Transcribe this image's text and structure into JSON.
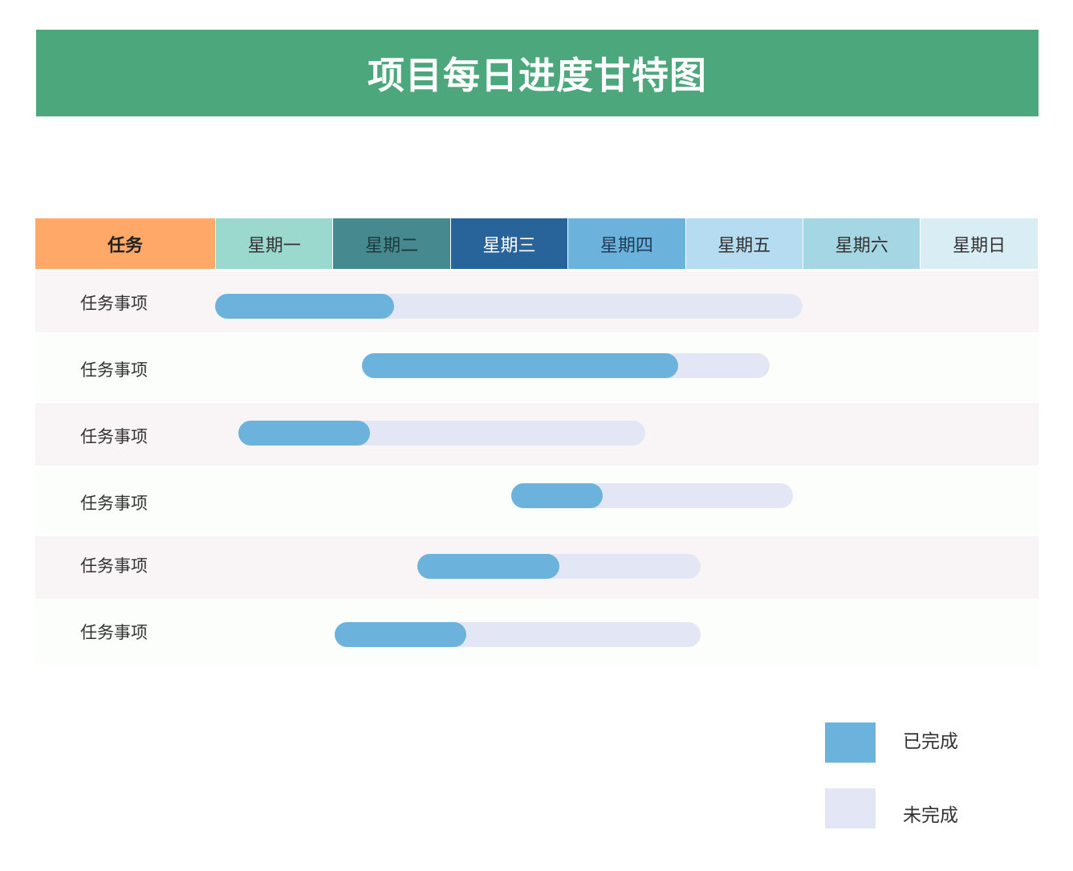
{
  "title": "项目每日进度甘特图",
  "chart_data": {
    "type": "bar",
    "subtype": "gantt",
    "title": "项目每日进度甘特图",
    "task_header": "任务",
    "days": [
      "星期一",
      "星期二",
      "星期三",
      "星期四",
      "星期五",
      "星期六",
      "星期日"
    ],
    "header_colors": {
      "task": "#ffa868",
      "days": [
        "#9bd9cf",
        "#468a90",
        "#28649a",
        "#6bb3dd",
        "#b5dcf0",
        "#a4d6e3",
        "#d9edf5"
      ],
      "text": [
        "#222222",
        "#333333",
        "#1b3940",
        "#ffffff",
        "#1f3b55",
        "#333333",
        "#333333",
        "#333333"
      ]
    },
    "tasks": [
      {
        "name": "任务事项",
        "start": 0.0,
        "done_end": 1.52,
        "end": 5.0
      },
      {
        "name": "任务事项",
        "start": 1.25,
        "done_end": 3.94,
        "end": 4.72
      },
      {
        "name": "任务事项",
        "start": 0.2,
        "done_end": 1.32,
        "end": 3.66
      },
      {
        "name": "任务事项",
        "start": 2.52,
        "done_end": 3.3,
        "end": 4.92
      },
      {
        "name": "任务事项",
        "start": 1.72,
        "done_end": 2.93,
        "end": 4.13
      },
      {
        "name": "任务事项",
        "start": 1.02,
        "done_end": 2.14,
        "end": 4.13
      }
    ],
    "legend": [
      {
        "label": "已完成",
        "color": "#6bb3dd"
      },
      {
        "label": "未完成",
        "color": "#e3e7f5"
      }
    ],
    "legend_position": "bottom-right",
    "row_colors": [
      "#f9f5f7",
      "#fcfefc"
    ]
  }
}
